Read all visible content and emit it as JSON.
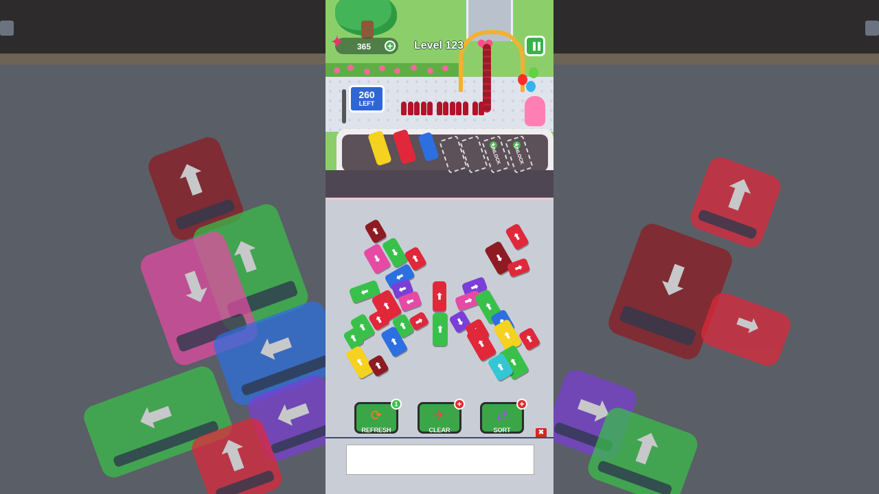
{
  "hud": {
    "coins": "365",
    "coin_plus": "+",
    "level": "Level 123",
    "people_left": "260",
    "people_left_label": "LEFT"
  },
  "parking": {
    "unlock_labels": [
      "UNLOCK",
      "UNLOCK"
    ],
    "unlock_plus": "+"
  },
  "boosters": [
    {
      "label": "REFRESH",
      "badge": "1",
      "icon": "refresh-car-icon"
    },
    {
      "label": "CLEAR",
      "badge": "+",
      "icon": "helicopter-icon"
    },
    {
      "label": "SORT",
      "badge": "+",
      "icon": "swap-person-icon"
    }
  ],
  "ad": {
    "close": "✖"
  },
  "colors": {
    "red": "#e0283a",
    "darkred": "#8e1a22",
    "green": "#39c04a",
    "blue": "#2c6fe0",
    "yellow": "#f4d21f",
    "pink": "#e64aa5",
    "purple": "#7a3fd6",
    "cyan": "#35c6d4"
  },
  "arrows": {
    "up": "⬆",
    "down": "⬇",
    "left": "⬅",
    "right": "➡"
  }
}
